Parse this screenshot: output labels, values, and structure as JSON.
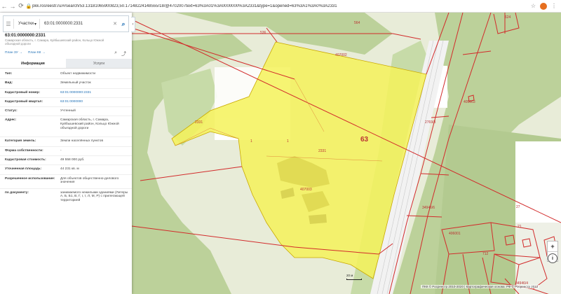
{
  "browser": {
    "url": "pkk.rosreestr.ru/#/search/53.13181065900823,50.17148224148555/18/@4702007text=63%3A01%3A0000000%3A2331&type=1&opened=63%3A1%3A0%3A2331",
    "back_icon": "arrow-left-icon",
    "forward_icon": "arrow-right-icon",
    "reload_icon": "reload-icon"
  },
  "search": {
    "type_label": "Участки",
    "query": "63:01:0000000:2331"
  },
  "object": {
    "title": "63:01:0000000:2331",
    "address_short": "Самарская область, г. Самара, Куйбышевский район, Кольцо Южной объездной дороги",
    "link_zu": "План ЗУ →",
    "link_kk": "План КК →"
  },
  "tabs": [
    {
      "label": "Информация",
      "active": true
    },
    {
      "label": "Услуги",
      "active": false
    }
  ],
  "rows": [
    {
      "key": "Тип:",
      "value": "Объект недвижимости",
      "link": false
    },
    {
      "key": "Вид:",
      "value": "Земельный участок",
      "link": false
    },
    {
      "key": "Кадастровый номер:",
      "value": "63:01:0000000:2331",
      "link": true
    },
    {
      "key": "Кадастровый квартал:",
      "value": "63:01:0000000",
      "link": true
    },
    {
      "key": "Статус:",
      "value": "Учтенный",
      "link": false
    },
    {
      "key": "Адрес:",
      "value": "Самарская область, г. Самара, Куйбышевский район, Кольцо Южной объездной дороги",
      "link": false
    },
    {
      "key": "Категория земель:",
      "value": "Земли населённых пунктов",
      "link": false
    },
    {
      "key": "Форма собственности:",
      "value": "-",
      "link": false
    },
    {
      "key": "Кадастровая стоимость:",
      "value": "49 558 000 руб.",
      "link": false
    },
    {
      "key": "Уточненная площадь:",
      "value": "44 231 кв. м",
      "link": false
    },
    {
      "key": "Разрешенное использование:",
      "value": "Для объектов общественно-делового значения",
      "link": false
    },
    {
      "key": "по документу:",
      "value": "занимаемого нежилыми зданиями (Литеры А, Б, Б1, В, Г, г, т, Л, М, Р) с прилегающей территорией",
      "link": false
    }
  ],
  "map": {
    "labels": {
      "parcel_big": "63",
      "q_407002": "407002",
      "q_407003": "407003",
      "q_405003": "405003",
      "q_406001": "406001",
      "p_2331_a": "2331",
      "p_2331_b": "2331",
      "p_1a": "1",
      "p_1b": "1",
      "p_536": "536",
      "p_564": "564",
      "p_624": "624",
      "p_2769_3": "2769/3",
      "p_34946_6": "34946/6",
      "p_34946_4": "34946/4",
      "p_712": "712",
      "p_21": "21",
      "p_27": "27"
    },
    "colors": {
      "parcel_fill": "#f4f25a",
      "boundary": "#d22b2b",
      "vegetation": "#bcd19a",
      "clearing": "#e8ecd8"
    },
    "scale_label": "20 м",
    "copyright": "ПКК © Росреестр 2010-2020 | Картографическая основа: РФ © Росреестр 2012"
  },
  "controls": {
    "zoom_in": "+",
    "zoom_out": "−",
    "info": "i"
  }
}
